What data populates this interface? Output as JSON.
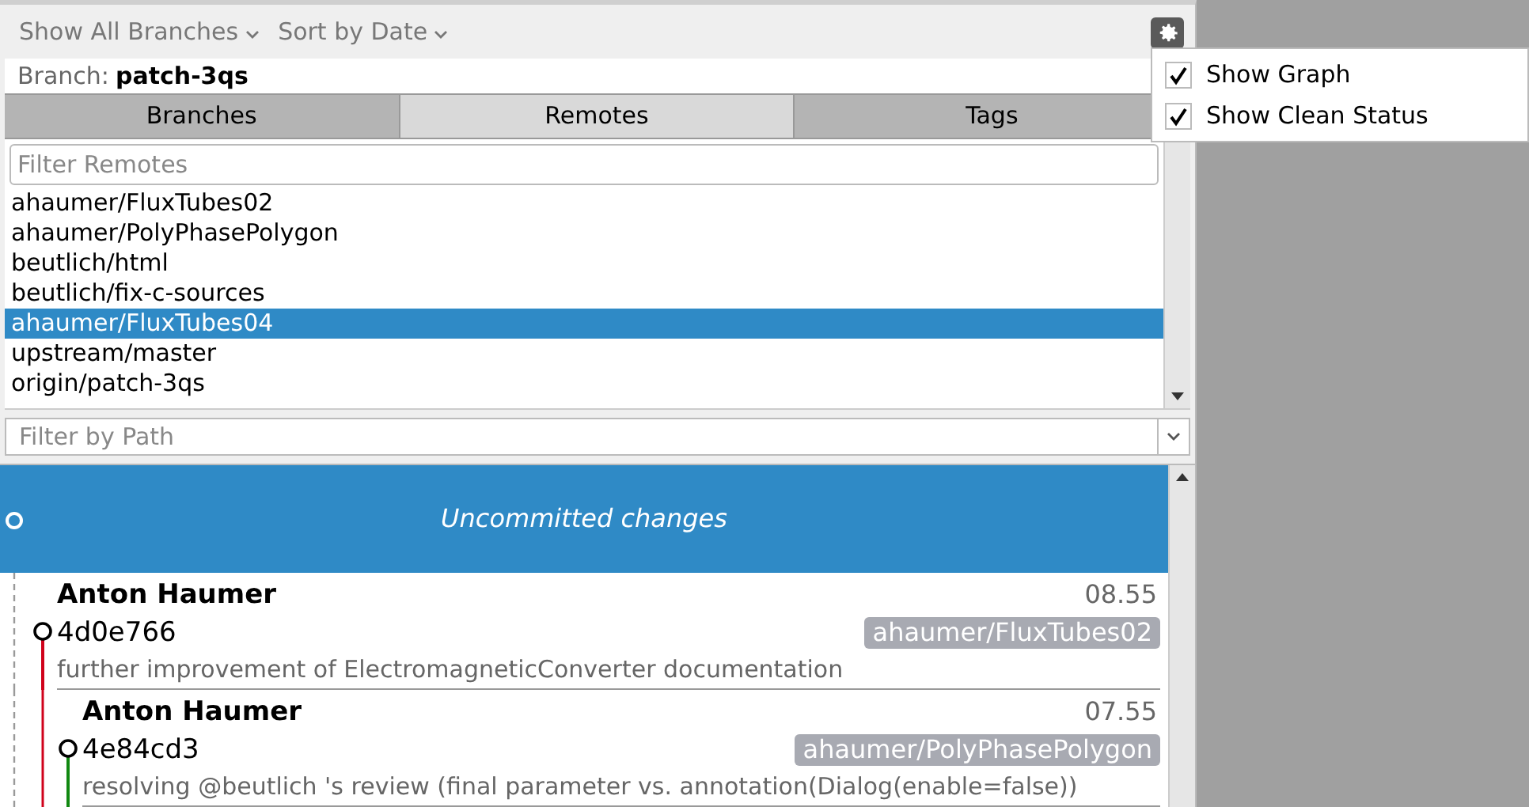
{
  "toolbar": {
    "branch_filter": "Show All Branches",
    "sort": "Sort by Date"
  },
  "current_branch": {
    "label": "Branch:",
    "name": "patch-3qs"
  },
  "tabs": [
    {
      "label": "Branches",
      "selected": false
    },
    {
      "label": "Remotes",
      "selected": true
    },
    {
      "label": "Tags",
      "selected": false
    }
  ],
  "remote_filter": {
    "placeholder": "Filter Remotes"
  },
  "remotes": [
    {
      "name": "ahaumer/FluxTubes02",
      "selected": false
    },
    {
      "name": "ahaumer/PolyPhasePolygon",
      "selected": false
    },
    {
      "name": "beutlich/html",
      "selected": false
    },
    {
      "name": "beutlich/fix-c-sources",
      "selected": false
    },
    {
      "name": "ahaumer/FluxTubes04",
      "selected": true
    },
    {
      "name": "upstream/master",
      "selected": false
    },
    {
      "name": "origin/patch-3qs",
      "selected": false
    }
  ],
  "path_filter": {
    "placeholder": "Filter by Path"
  },
  "uncommitted": {
    "label": "Uncommitted changes"
  },
  "commits": [
    {
      "author": "Anton Haumer",
      "hash": "4d0e766",
      "message": "further improvement of ElectromagneticConverter documentation",
      "time": "08.55",
      "branch": "ahaumer/FluxTubes02",
      "color": "#d0021b"
    },
    {
      "author": "Anton Haumer",
      "hash": "4e84cd3",
      "message": "resolving @beutlich 's review (final parameter vs. annotation(Dialog(enable=false))",
      "time": "07.55",
      "branch": "ahaumer/PolyPhasePolygon",
      "color": "#118811"
    }
  ],
  "settings_menu": [
    {
      "label": "Show Graph",
      "checked": true
    },
    {
      "label": "Show Clean Status",
      "checked": true
    }
  ]
}
